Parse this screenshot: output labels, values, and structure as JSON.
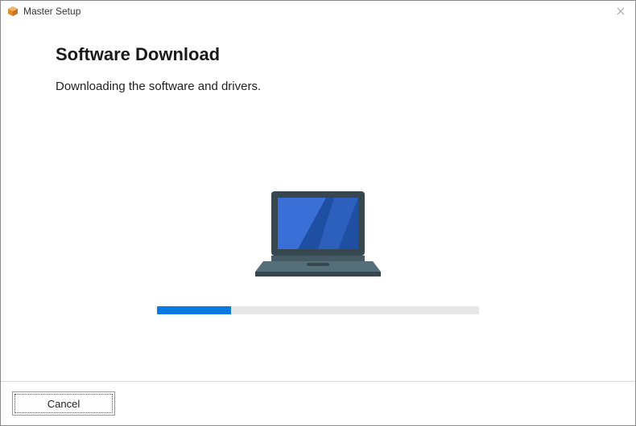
{
  "window": {
    "title": "Master Setup"
  },
  "content": {
    "heading": "Software Download",
    "subtext": "Downloading the software and drivers."
  },
  "progress": {
    "percent": 23
  },
  "footer": {
    "cancel_label": "Cancel"
  },
  "icons": {
    "app": "package-icon",
    "close": "close-icon",
    "illustration": "laptop-icon"
  },
  "colors": {
    "accent": "#0a7ae0",
    "progress_track": "#e6e6e6",
    "laptop_frame": "#37474F",
    "laptop_screen_dark": "#1E4FA3",
    "laptop_screen_light": "#3B6FD8",
    "laptop_base": "#546E7A"
  }
}
